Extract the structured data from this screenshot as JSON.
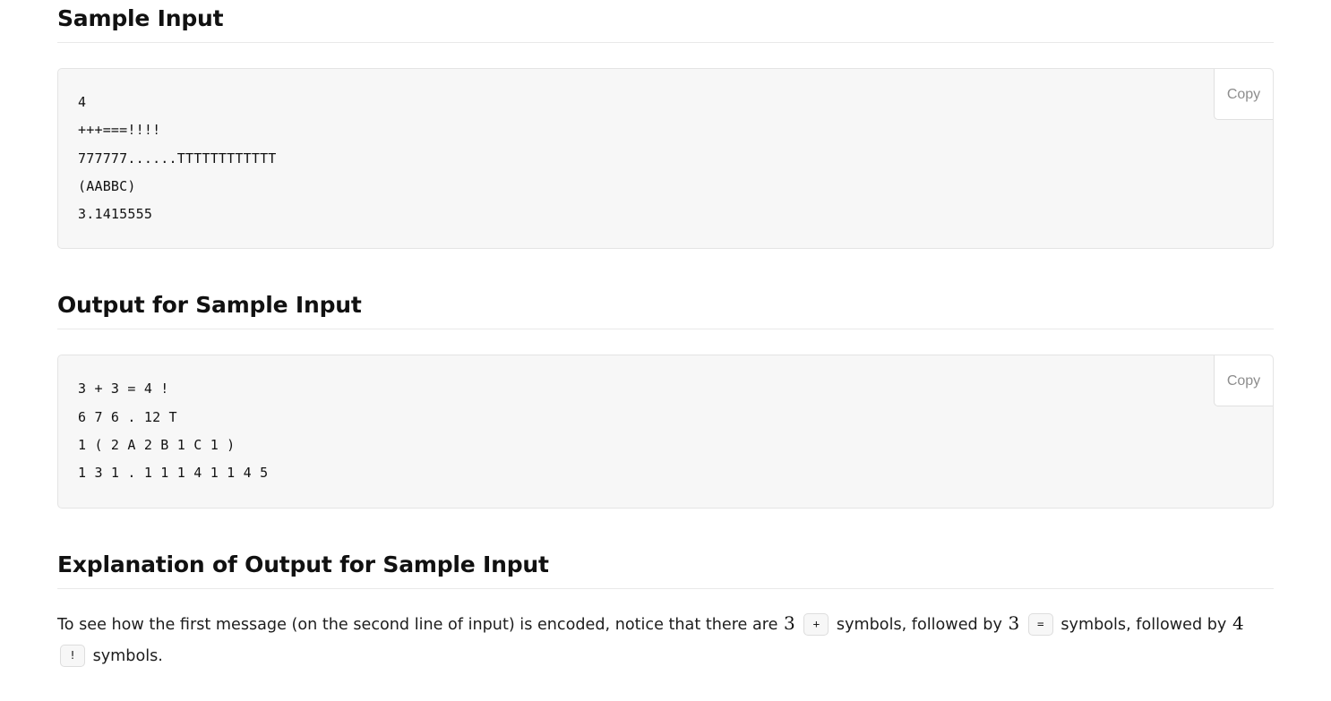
{
  "sections": {
    "sample_input": {
      "heading": "Sample Input",
      "copy_label": "Copy",
      "code": "4\n+++===!!!!\n777777......TTTTTTTTTTTT\n(AABBC)\n3.1415555"
    },
    "sample_output": {
      "heading": "Output for Sample Input",
      "copy_label": "Copy",
      "code": "3 + 3 = 4 !\n6 7 6 . 12 T\n1 ( 2 A 2 B 1 C 1 )\n1 3 1 . 1 1 1 4 1 1 4 5"
    },
    "explanation": {
      "heading": "Explanation of Output for Sample Input",
      "text_1": "To see how the first message (on the second line of input) is encoded, notice that there are",
      "count_1": "3",
      "symbol_1": "+",
      "text_2": "symbols, followed by",
      "count_2": "3",
      "symbol_2": "=",
      "text_3": "symbols, followed by",
      "count_3": "4",
      "symbol_3": "!",
      "text_4": "symbols."
    }
  },
  "colors": {
    "code_bg": "#f7f7f7",
    "code_border": "#e4e4e4",
    "rule": "#e9e9e9",
    "copy_text": "#8d8d8d",
    "heading": "#111111"
  }
}
